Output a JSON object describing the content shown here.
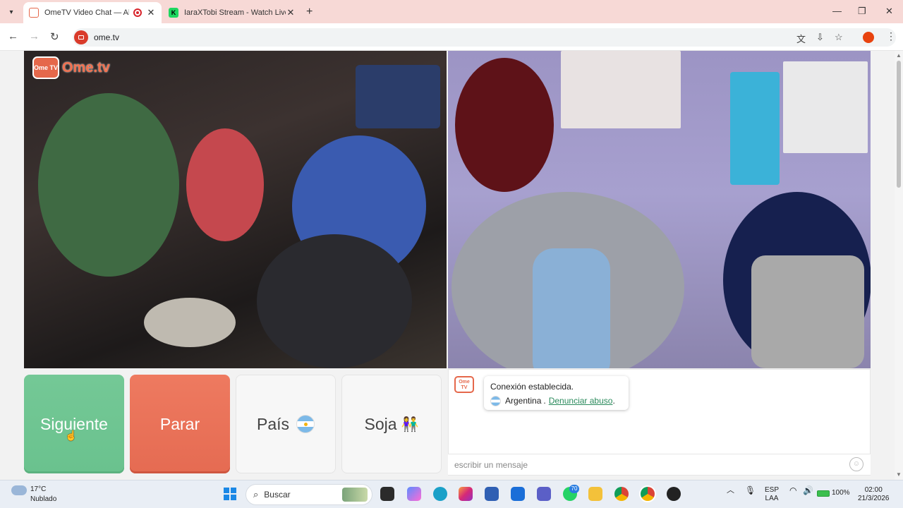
{
  "browser": {
    "tabs": [
      {
        "title": "OmeTV Video Chat — Alter",
        "active": true,
        "favicon_color": "#e5684b",
        "recording": true
      },
      {
        "title": "IaraXTobi Stream - Watch Live c",
        "active": false,
        "favicon_color": "#1ed760"
      }
    ],
    "url": "ome.tv",
    "controls": {
      "minimize": "—",
      "maximize": "❐",
      "close": "✕",
      "new_tab": "+"
    },
    "profile_color": "#e8430f"
  },
  "site": {
    "logo_box": "Ome TV",
    "logo_text": "Ome.tv"
  },
  "controls": {
    "next": "Siguiente",
    "stop": "Parar",
    "country": "País",
    "gender": "Soja"
  },
  "chat": {
    "status": "Conexión establecida.",
    "country": "Argentina",
    "separator": ".",
    "report": "Denunciar abuso",
    "report_end": ".",
    "placeholder": "escribir un mensaje"
  },
  "taskbar": {
    "temp": "17°C",
    "weather": "Nublado",
    "search": "Buscar",
    "whatsapp_badge": "70",
    "lang1": "ESP",
    "lang2": "LAA",
    "battery": "100%",
    "time": "02:00",
    "date": "21/3/2026"
  },
  "colors": {
    "next": "#6ac28e",
    "stop": "#e56b52",
    "brand": "#e5684b",
    "link": "#2a8a5c"
  }
}
